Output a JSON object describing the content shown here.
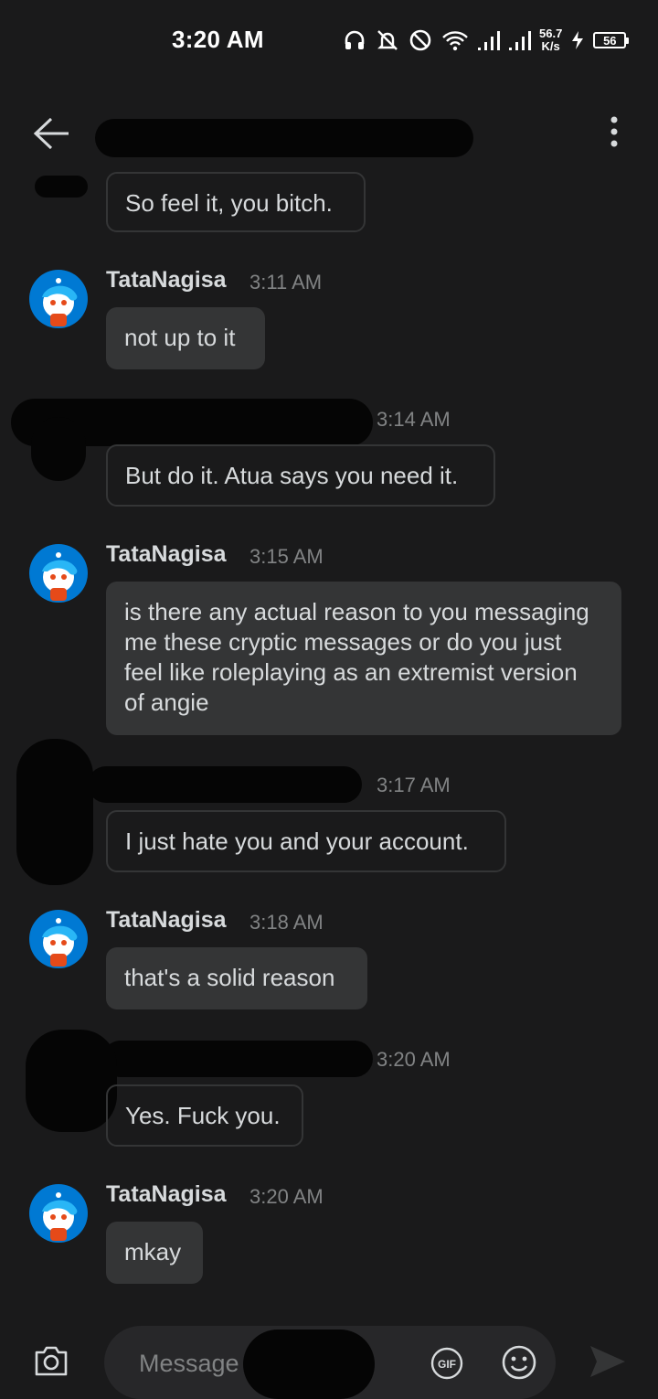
{
  "status_bar": {
    "time": "3:20 AM",
    "speed_value": "56.7",
    "speed_unit": "K/s",
    "battery": "56",
    "icons": [
      "headset-icon",
      "bell-off-icon",
      "do-not-disturb-icon",
      "wifi-icon",
      "signal-icon",
      "signal-icon",
      "charging-icon",
      "battery-icon"
    ]
  },
  "header": {
    "back_icon": "arrow-left-icon",
    "more_icon": "more-vertical-icon"
  },
  "messages": [
    {
      "type": "outgoing",
      "text": "So feel it, you bitch."
    },
    {
      "type": "incoming",
      "author": "TataNagisa",
      "time": "3:11 AM",
      "text": "not up to it"
    },
    {
      "type": "outgoing",
      "time": "3:14 AM",
      "text": "But do it. Atua says you need it."
    },
    {
      "type": "incoming",
      "author": "TataNagisa",
      "time": "3:15 AM",
      "text": "is there any actual reason to you messaging me these cryptic messages or do you just feel like roleplaying as an extremist version of angie"
    },
    {
      "type": "outgoing",
      "time": "3:17 AM",
      "text": "I just hate you and your account."
    },
    {
      "type": "incoming",
      "author": "TataNagisa",
      "time": "3:18 AM",
      "text": "that's a solid reason"
    },
    {
      "type": "outgoing",
      "time": "3:20 AM",
      "text": "Yes. Fuck you."
    },
    {
      "type": "incoming",
      "author": "TataNagisa",
      "time": "3:20 AM",
      "text": "mkay"
    }
  ],
  "composer": {
    "placeholder": "Message",
    "gif_label": "GIF",
    "icons": [
      "camera-icon",
      "gif-icon",
      "emoji-icon",
      "send-icon"
    ]
  },
  "colors": {
    "background": "#1a1a1b",
    "incoming_bubble": "#343536",
    "outgoing_border": "#343536",
    "text": "#d7dadc",
    "muted": "#818384",
    "avatar_bg": "#0079d3",
    "redaction": "#050505"
  }
}
